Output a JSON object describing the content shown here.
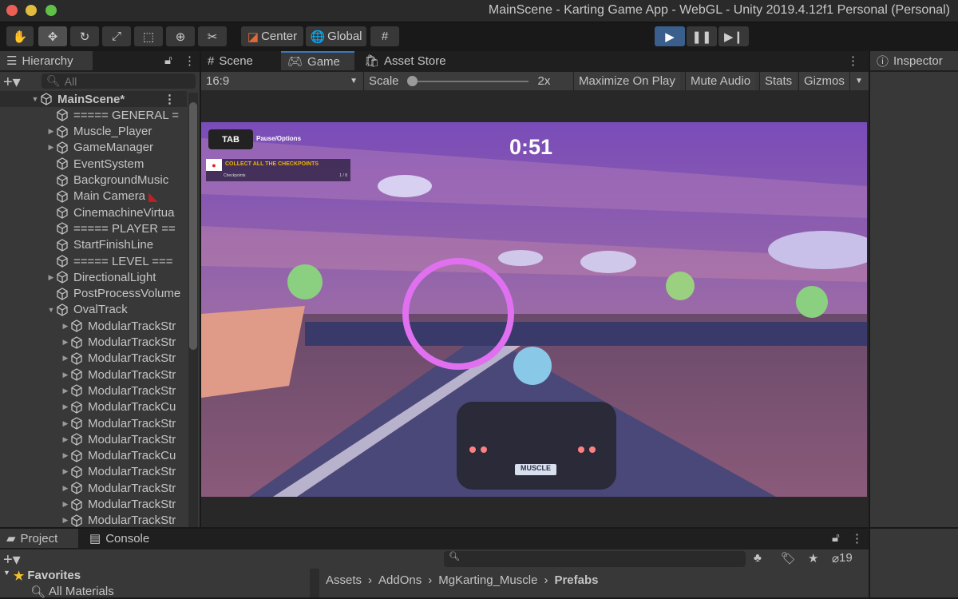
{
  "window": {
    "title": "MainScene - Karting Game App - WebGL - Unity 2019.4.12f1 Personal (Personal)"
  },
  "toolbar": {
    "tools": [
      "hand-tool",
      "move-tool",
      "rotate-tool",
      "scale-tool",
      "rect-tool",
      "transform-tool",
      "custom-tool"
    ],
    "pivot": "Center",
    "space": "Global"
  },
  "hierarchy": {
    "tab": "Hierarchy",
    "search_placeholder": "All",
    "items": [
      {
        "label": "MainScene*",
        "level": 0,
        "arrow": "down",
        "scene": true
      },
      {
        "label": "===== GENERAL =",
        "level": 1,
        "arrow": ""
      },
      {
        "label": "Muscle_Player",
        "level": 1,
        "arrow": "right"
      },
      {
        "label": "GameManager",
        "level": 1,
        "arrow": "right"
      },
      {
        "label": "EventSystem",
        "level": 1,
        "arrow": ""
      },
      {
        "label": "BackgroundMusic",
        "level": 1,
        "arrow": ""
      },
      {
        "label": "Main Camera",
        "level": 1,
        "arrow": "",
        "badge": true
      },
      {
        "label": "CinemachineVirtua",
        "level": 1,
        "arrow": ""
      },
      {
        "label": "===== PLAYER ==",
        "level": 1,
        "arrow": ""
      },
      {
        "label": "StartFinishLine",
        "level": 1,
        "arrow": ""
      },
      {
        "label": "===== LEVEL ===",
        "level": 1,
        "arrow": ""
      },
      {
        "label": "DirectionalLight",
        "level": 1,
        "arrow": "right"
      },
      {
        "label": "PostProcessVolume",
        "level": 1,
        "arrow": ""
      },
      {
        "label": "OvalTrack",
        "level": 1,
        "arrow": "down"
      },
      {
        "label": "ModularTrackStr",
        "level": 2,
        "arrow": "right"
      },
      {
        "label": "ModularTrackStr",
        "level": 2,
        "arrow": "right"
      },
      {
        "label": "ModularTrackStr",
        "level": 2,
        "arrow": "right"
      },
      {
        "label": "ModularTrackStr",
        "level": 2,
        "arrow": "right"
      },
      {
        "label": "ModularTrackStr",
        "level": 2,
        "arrow": "right"
      },
      {
        "label": "ModularTrackCu",
        "level": 2,
        "arrow": "right"
      },
      {
        "label": "ModularTrackStr",
        "level": 2,
        "arrow": "right"
      },
      {
        "label": "ModularTrackStr",
        "level": 2,
        "arrow": "right"
      },
      {
        "label": "ModularTrackCu",
        "level": 2,
        "arrow": "right"
      },
      {
        "label": "ModularTrackStr",
        "level": 2,
        "arrow": "right"
      },
      {
        "label": "ModularTrackStr",
        "level": 2,
        "arrow": "right"
      },
      {
        "label": "ModularTrackStr",
        "level": 2,
        "arrow": "right"
      },
      {
        "label": "ModularTrackStr",
        "level": 2,
        "arrow": "right"
      }
    ]
  },
  "center_tabs": [
    "Scene",
    "Game",
    "Asset Store"
  ],
  "game_toolbar": {
    "aspect": "16:9",
    "scale_label": "Scale",
    "scale_value": "2x",
    "scale_fraction": 0,
    "maximize": "Maximize On Play",
    "mute": "Mute Audio",
    "stats": "Stats",
    "gizmos": "Gizmos"
  },
  "game_hud": {
    "tab_key": "TAB",
    "pause": "Pause/Options",
    "timer": "0:51",
    "objective": "COLLECT ALL THE CHECKPOINTS",
    "objective_sub": "Checkpoints",
    "objective_count": "1 / 8",
    "plate": "MUSCLE"
  },
  "inspector": {
    "tab": "Inspector"
  },
  "bottom": {
    "tabs": [
      "Project",
      "Console"
    ],
    "hidden_count": "19",
    "favorites": "Favorites",
    "favorite_items": [
      "All Materials"
    ],
    "breadcrumb": [
      "Assets",
      "AddOns",
      "MgKarting_Muscle",
      "Prefabs"
    ]
  },
  "colors": {
    "accent": "#3a79bb",
    "play": "#3a5f8c",
    "hud_yellow": "#f0b400"
  }
}
